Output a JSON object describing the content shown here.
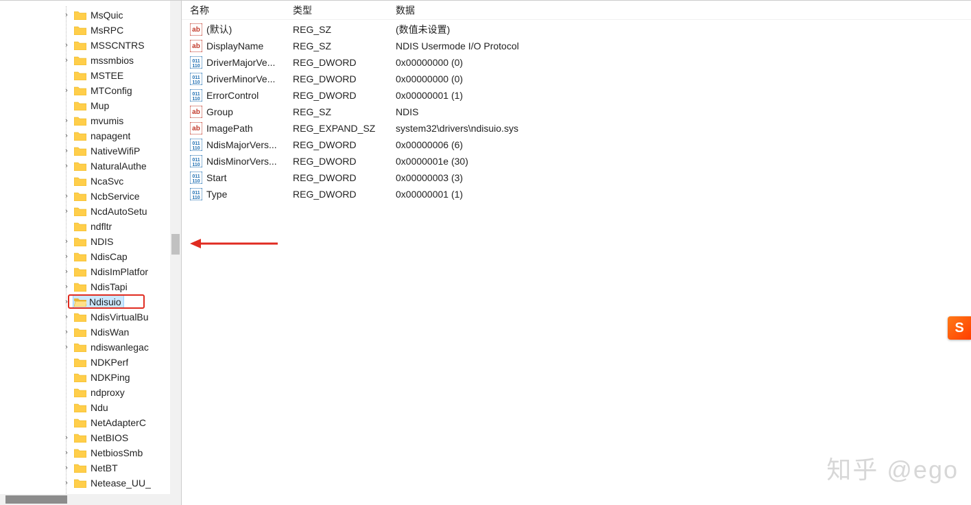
{
  "columns": {
    "name": "名称",
    "type": "类型",
    "data": "数据"
  },
  "tree": [
    {
      "label": "MsQuic",
      "expand": true
    },
    {
      "label": "MsRPC",
      "expand": false
    },
    {
      "label": "MSSCNTRS",
      "expand": true
    },
    {
      "label": "mssmbios",
      "expand": true
    },
    {
      "label": "MSTEE",
      "expand": false
    },
    {
      "label": "MTConfig",
      "expand": true
    },
    {
      "label": "Mup",
      "expand": false
    },
    {
      "label": "mvumis",
      "expand": true
    },
    {
      "label": "napagent",
      "expand": true
    },
    {
      "label": "NativeWifiP",
      "expand": true
    },
    {
      "label": "NaturalAuthe",
      "expand": true
    },
    {
      "label": "NcaSvc",
      "expand": false
    },
    {
      "label": "NcbService",
      "expand": true
    },
    {
      "label": "NcdAutoSetu",
      "expand": true
    },
    {
      "label": "ndfltr",
      "expand": false
    },
    {
      "label": "NDIS",
      "expand": true
    },
    {
      "label": "NdisCap",
      "expand": true
    },
    {
      "label": "NdisImPlatfor",
      "expand": true
    },
    {
      "label": "NdisTapi",
      "expand": true
    },
    {
      "label": "Ndisuio",
      "expand": true,
      "selected": true
    },
    {
      "label": "NdisVirtualBu",
      "expand": true
    },
    {
      "label": "NdisWan",
      "expand": true
    },
    {
      "label": "ndiswanlegac",
      "expand": true
    },
    {
      "label": "NDKPerf",
      "expand": false
    },
    {
      "label": "NDKPing",
      "expand": false
    },
    {
      "label": "ndproxy",
      "expand": false
    },
    {
      "label": "Ndu",
      "expand": false
    },
    {
      "label": "NetAdapterC",
      "expand": false
    },
    {
      "label": "NetBIOS",
      "expand": true
    },
    {
      "label": "NetbiosSmb",
      "expand": true
    },
    {
      "label": "NetBT",
      "expand": true
    },
    {
      "label": "Netease_UU_",
      "expand": true
    }
  ],
  "values": [
    {
      "kind": "sz",
      "name": "(默认)",
      "type": "REG_SZ",
      "data": "(数值未设置)"
    },
    {
      "kind": "sz",
      "name": "DisplayName",
      "type": "REG_SZ",
      "data": "NDIS Usermode I/O Protocol"
    },
    {
      "kind": "dw",
      "name": "DriverMajorVe...",
      "type": "REG_DWORD",
      "data": "0x00000000 (0)"
    },
    {
      "kind": "dw",
      "name": "DriverMinorVe...",
      "type": "REG_DWORD",
      "data": "0x00000000 (0)"
    },
    {
      "kind": "dw",
      "name": "ErrorControl",
      "type": "REG_DWORD",
      "data": "0x00000001 (1)"
    },
    {
      "kind": "sz",
      "name": "Group",
      "type": "REG_SZ",
      "data": "NDIS"
    },
    {
      "kind": "sz",
      "name": "ImagePath",
      "type": "REG_EXPAND_SZ",
      "data": "system32\\drivers\\ndisuio.sys"
    },
    {
      "kind": "dw",
      "name": "NdisMajorVers...",
      "type": "REG_DWORD",
      "data": "0x00000006 (6)"
    },
    {
      "kind": "dw",
      "name": "NdisMinorVers...",
      "type": "REG_DWORD",
      "data": "0x0000001e (30)"
    },
    {
      "kind": "dw",
      "name": "Start",
      "type": "REG_DWORD",
      "data": "0x00000003 (3)"
    },
    {
      "kind": "dw",
      "name": "Type",
      "type": "REG_DWORD",
      "data": "0x00000001 (1)"
    }
  ],
  "watermark": "知乎 @ego",
  "badge": "S"
}
